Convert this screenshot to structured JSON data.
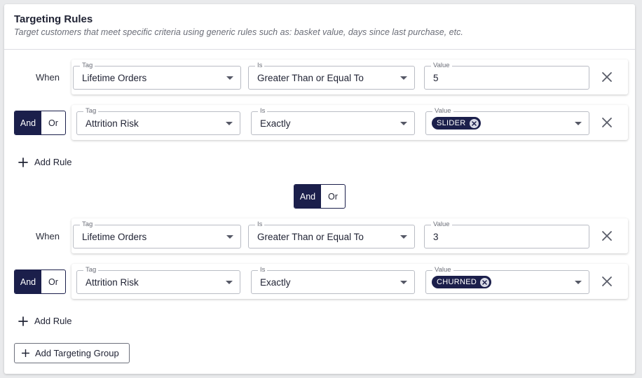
{
  "header": {
    "title": "Targeting Rules",
    "subtitle": "Target customers that meet specific criteria using generic rules such as: basket value, days since last purchase, etc."
  },
  "field_labels": {
    "tag": "Tag",
    "is": "Is",
    "value": "Value"
  },
  "groups": [
    {
      "rules": [
        {
          "prefix": "When",
          "tag": "Lifetime Orders",
          "operator": "Greater Than or Equal To",
          "value": "5"
        },
        {
          "conjunction": {
            "and": "And",
            "or": "Or",
            "selected": "And"
          },
          "tag": "Attrition Risk",
          "operator": "Exactly",
          "value_chip": "SLIDER"
        }
      ],
      "add_rule_label": "Add Rule"
    },
    {
      "rules": [
        {
          "prefix": "When",
          "tag": "Lifetime Orders",
          "operator": "Greater Than or Equal To",
          "value": "3"
        },
        {
          "conjunction": {
            "and": "And",
            "or": "Or",
            "selected": "And"
          },
          "tag": "Attrition Risk",
          "operator": "Exactly",
          "value_chip": "CHURNED"
        }
      ],
      "add_rule_label": "Add Rule"
    }
  ],
  "group_conjunction": {
    "and": "And",
    "or": "Or",
    "selected": "And"
  },
  "add_group_label": "Add Targeting Group",
  "colors": {
    "accent": "#1b1f4b",
    "border": "#b9bcc4",
    "text": "#1f2233",
    "muted": "#6b6e78"
  },
  "icons": {
    "close": "close-icon",
    "caret": "chevron-down-icon",
    "add": "plus-icon",
    "chip_remove": "chip-remove-icon"
  }
}
